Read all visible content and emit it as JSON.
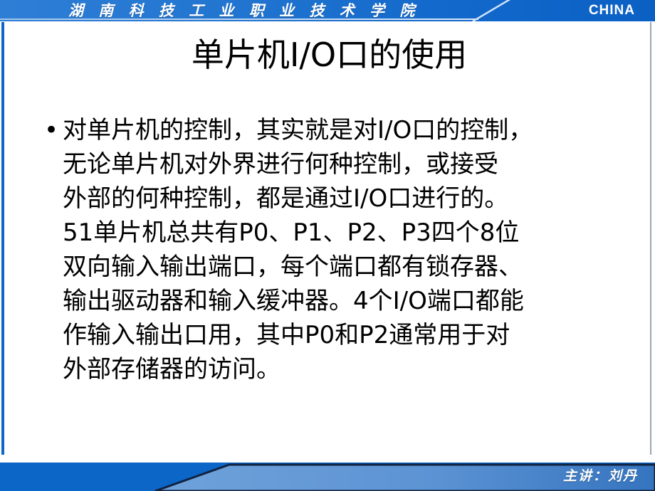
{
  "header": {
    "institution": "湖 南 科 技 工 业 职 业 技 术 学 院",
    "country": "CHINA",
    "accent_color": "#0b66c8"
  },
  "slide": {
    "title": "单片机I/O口的使用",
    "bullet_marker": "•",
    "body_lines": [
      "对单片机的控制，其实就是对I/O口的控制，",
      "无论单片机对外界进行何种控制，或接受",
      "外部的何种控制，都是通过I/O口进行的。",
      "51单片机总共有P0、P1、P2、P3四个8位",
      "双向输入输出端口，每个端口都有锁存器、",
      "输出驱动器和输入缓冲器。4个I/O端口都能",
      "作输入输出口用，其中P0和P2通常用于对",
      "外部存储器的访问。"
    ],
    "body_text": "对单片机的控制，其实就是对I/O口的控制，无论单片机对外界进行何种控制，或接受外部的何种控制，都是通过I/O口进行的。51单片机总共有P0、P1、P2、P3四个8位双向输入输出端口，每个端口都有锁存器、输出驱动器和输入缓冲器。4个I/O端口都能作输入输出口用，其中P0和P2通常用于对外部存储器的访问。"
  },
  "footer": {
    "presenter": "主讲：刘丹",
    "band_color": "#0b66c8",
    "shape_color_light": "#6b9fd8",
    "shape_color_dark": "#3f7fc6"
  }
}
